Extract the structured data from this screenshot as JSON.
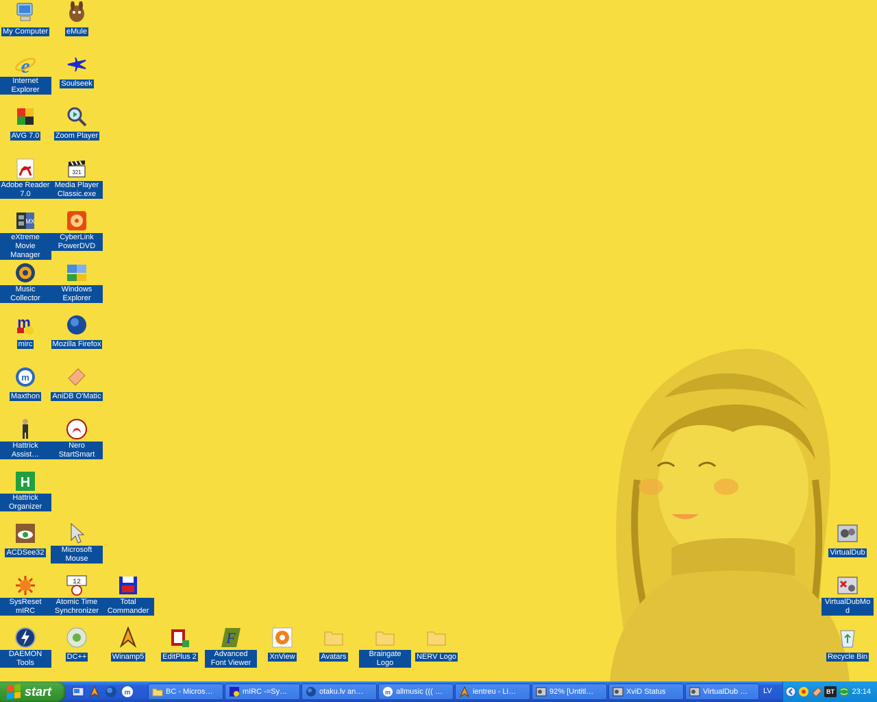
{
  "desktop_icons": [
    {
      "label": "My Computer",
      "icon": "computer-icon"
    },
    {
      "label": "eMule",
      "icon": "emule-icon"
    },
    {
      "label": "Internet Explorer",
      "icon": "internet-explorer-icon"
    },
    {
      "label": "Soulseek",
      "icon": "soulseek-icon"
    },
    {
      "label": "AVG 7.0",
      "icon": "avg-icon"
    },
    {
      "label": "Zoom Player",
      "icon": "zoom-player-icon"
    },
    {
      "label": "Adobe Reader 7.0",
      "icon": "adobe-reader-icon"
    },
    {
      "label": "Media Player Classic.exe",
      "icon": "clapperboard-icon"
    },
    {
      "label": "eXtreme Movie Manager",
      "icon": "film-icon"
    },
    {
      "label": "CyberLink PowerDVD",
      "icon": "powerdvd-icon"
    },
    {
      "label": "Music Collector",
      "icon": "music-collector-icon"
    },
    {
      "label": "Windows Explorer",
      "icon": "windows-explorer-icon"
    },
    {
      "label": "mirc",
      "icon": "mirc-icon"
    },
    {
      "label": "Mozilla Firefox",
      "icon": "firefox-icon"
    },
    {
      "label": "Maxthon",
      "icon": "maxthon-icon"
    },
    {
      "label": "AniDB O'Matic",
      "icon": "anidb-icon"
    },
    {
      "label": "Hattrick Assist…",
      "icon": "person-icon"
    },
    {
      "label": "Nero StartSmart",
      "icon": "nero-icon"
    },
    {
      "label": "Hattrick Organizer",
      "icon": "hattrick-organizer-icon"
    },
    {
      "label": "ACDSee32",
      "icon": "acdsee-icon"
    },
    {
      "label": "Microsoft Mouse",
      "icon": "mouse-pointer-icon"
    },
    {
      "label": "SysReset mIRC",
      "icon": "sysreset-icon"
    },
    {
      "label": "Atomic Time Synchronizer",
      "icon": "atomic-clock-icon"
    },
    {
      "label": "Total Commander",
      "icon": "floppy-disk-icon"
    },
    {
      "label": "DAEMON Tools",
      "icon": "daemon-tools-icon"
    },
    {
      "label": "DC++",
      "icon": "dcpp-icon"
    },
    {
      "label": "Winamp5",
      "icon": "winamp-icon"
    },
    {
      "label": "EditPlus 2",
      "icon": "editplus-icon"
    },
    {
      "label": "Advanced Font Viewer",
      "icon": "font-viewer-icon"
    },
    {
      "label": "XnView",
      "icon": "xnview-icon"
    },
    {
      "label": "Avatars",
      "icon": "folder-icon"
    },
    {
      "label": "Braingate Logo",
      "icon": "folder-icon"
    },
    {
      "label": "NERV Logo",
      "icon": "folder-icon"
    },
    {
      "label": "VirtualDub",
      "icon": "virtualdub-icon"
    },
    {
      "label": "VirtualDubMod",
      "icon": "virtualdubmod-icon"
    },
    {
      "label": "Recycle Bin",
      "icon": "recycle-bin-icon"
    }
  ],
  "taskbar": {
    "start_label": "start",
    "quick_launch": [
      "show-desktop-icon",
      "winamp-icon",
      "firefox-icon",
      "maxthon-icon"
    ],
    "tasks": [
      {
        "label": "BC - Micros…",
        "icon": "folder-icon"
      },
      {
        "label": "mIRC -=Sy…",
        "icon": "mirc-icon"
      },
      {
        "label": "otaku.lv an…",
        "icon": "firefox-icon"
      },
      {
        "label": "allmusic ((( …",
        "icon": "maxthon-icon"
      },
      {
        "label": "ientreu - Li…",
        "icon": "winamp-icon"
      },
      {
        "label": "92% [Untitl…",
        "icon": "virtualdub-icon"
      },
      {
        "label": "XviD Status",
        "icon": "virtualdub-icon"
      },
      {
        "label": "VirtualDub …",
        "icon": "virtualdub-icon"
      }
    ],
    "language": "LV",
    "tray_icons": [
      "tray-arrow-icon",
      "tray-media-icon",
      "tray-anidb-icon",
      "bittorrent-icon",
      "network-globe-icon"
    ],
    "tray_bt_text": "BT",
    "clock": "23:14"
  },
  "colors": {
    "desktop": "#f7dd3f",
    "label_bg": "#0b4f9c",
    "taskbar": "#2358d2",
    "start": "#3b9a36"
  }
}
